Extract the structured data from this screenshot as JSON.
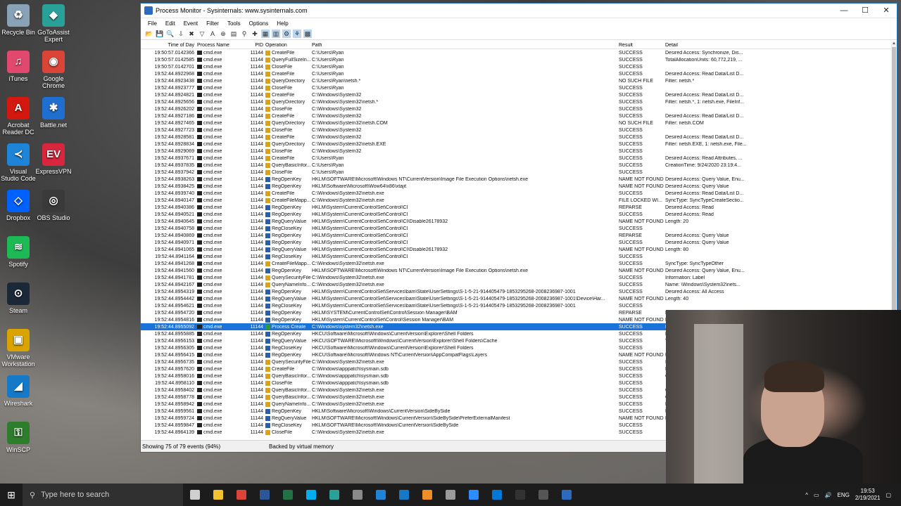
{
  "desktop_icons": [
    {
      "label": "Recycle Bin",
      "icon": "recycle-bin-icon",
      "color": "#8aa2b8",
      "glyph": "♻",
      "x": 0
    },
    {
      "label": "GoToAssist Expert",
      "icon": "gotoassist-icon",
      "color": "#2aa198",
      "glyph": "◆",
      "x": 1
    },
    {
      "label": "iTunes",
      "icon": "itunes-icon",
      "color": "#e0486e",
      "glyph": "♫",
      "x": 0
    },
    {
      "label": "Google Chrome",
      "icon": "chrome-icon",
      "color": "#db4437",
      "glyph": "◉",
      "x": 1
    },
    {
      "label": "Acrobat Reader DC",
      "icon": "acrobat-icon",
      "color": "#d4170f",
      "glyph": "A",
      "x": 0
    },
    {
      "label": "Battle.net",
      "icon": "battlenet-icon",
      "color": "#1f6fd1",
      "glyph": "✱",
      "x": 1
    },
    {
      "label": "Visual Studio Code",
      "icon": "vscode-icon",
      "color": "#1d84d8",
      "glyph": "≺",
      "x": 0
    },
    {
      "label": "ExpressVPN",
      "icon": "expressvpn-icon",
      "color": "#d7263d",
      "glyph": "EV",
      "x": 1
    },
    {
      "label": "Dropbox",
      "icon": "dropbox-icon",
      "color": "#0061fe",
      "glyph": "◇",
      "x": 0
    },
    {
      "label": "OBS Studio",
      "icon": "obs-icon",
      "color": "#3a3a3a",
      "glyph": "◎",
      "x": 1
    },
    {
      "label": "Spotify",
      "icon": "spotify-icon",
      "color": "#1db954",
      "glyph": "≋",
      "x": 0
    },
    {
      "label": "Steam",
      "icon": "steam-icon",
      "color": "#1b2838",
      "glyph": "⊙",
      "x": 0
    },
    {
      "label": "VMware Workstation",
      "icon": "vmware-icon",
      "color": "#d9a400",
      "glyph": "▣",
      "x": 0
    },
    {
      "label": "Wireshark",
      "icon": "wireshark-icon",
      "color": "#1679c8",
      "glyph": "◢",
      "x": 0
    },
    {
      "label": "WinSCP",
      "icon": "winscp-icon",
      "color": "#2d7d2d",
      "glyph": "⚿",
      "x": 0
    }
  ],
  "window": {
    "title": "Process Monitor - Sysinternals: www.sysinternals.com",
    "menu": [
      "File",
      "Edit",
      "Event",
      "Filter",
      "Tools",
      "Options",
      "Help"
    ],
    "columns": {
      "time": "Time of Day",
      "process": "Process Name",
      "pid": "PID",
      "operation": "Operation",
      "path": "Path",
      "result": "Result",
      "detail": "Detail"
    },
    "rows": [
      {
        "time": "19:50:57.0142366",
        "proc": "cmd.exe",
        "pid": "11144",
        "op": "CreateFile",
        "t": "file",
        "path": "C:\\Users\\Ryan",
        "res": "SUCCESS",
        "det": "Desired Access: Synchronize, Dis..."
      },
      {
        "time": "19:50:57.0142585",
        "proc": "cmd.exe",
        "pid": "11144",
        "op": "QueryFullSizeIn...",
        "t": "file",
        "path": "C:\\Users\\Ryan",
        "res": "SUCCESS",
        "det": "TotalAllocationUnits: 60,772,219, ..."
      },
      {
        "time": "19:50:57.0142701",
        "proc": "cmd.exe",
        "pid": "11144",
        "op": "CloseFile",
        "t": "file",
        "path": "C:\\Users\\Ryan",
        "res": "SUCCESS",
        "det": ""
      },
      {
        "time": "19:52:44.8922968",
        "proc": "cmd.exe",
        "pid": "11144",
        "op": "CreateFile",
        "t": "file",
        "path": "C:\\Users\\Ryan",
        "res": "SUCCESS",
        "det": "Desired Access: Read Data/List D..."
      },
      {
        "time": "19:52:44.8923438",
        "proc": "cmd.exe",
        "pid": "11144",
        "op": "QueryDirectory",
        "t": "file",
        "path": "C:\\Users\\Ryan\\netsh.*",
        "res": "NO SUCH FILE",
        "det": "Filter: netsh.*"
      },
      {
        "time": "19:52:44.8923777",
        "proc": "cmd.exe",
        "pid": "11144",
        "op": "CloseFile",
        "t": "file",
        "path": "C:\\Users\\Ryan",
        "res": "SUCCESS",
        "det": ""
      },
      {
        "time": "19:52:44.8924821",
        "proc": "cmd.exe",
        "pid": "11144",
        "op": "CreateFile",
        "t": "file",
        "path": "C:\\Windows\\System32",
        "res": "SUCCESS",
        "det": "Desired Access: Read Data/List D..."
      },
      {
        "time": "19:52:44.8925656",
        "proc": "cmd.exe",
        "pid": "11144",
        "op": "QueryDirectory",
        "t": "file",
        "path": "C:\\Windows\\System32\\netsh.*",
        "res": "SUCCESS",
        "det": "Filter: netsh.*, 1: netsh.exe, FileInf..."
      },
      {
        "time": "19:52:44.8926202",
        "proc": "cmd.exe",
        "pid": "11144",
        "op": "CloseFile",
        "t": "file",
        "path": "C:\\Windows\\System32",
        "res": "SUCCESS",
        "det": ""
      },
      {
        "time": "19:52:44.8927186",
        "proc": "cmd.exe",
        "pid": "11144",
        "op": "CreateFile",
        "t": "file",
        "path": "C:\\Windows\\System32",
        "res": "SUCCESS",
        "det": "Desired Access: Read Data/List D..."
      },
      {
        "time": "19:52:44.8927465",
        "proc": "cmd.exe",
        "pid": "11144",
        "op": "QueryDirectory",
        "t": "file",
        "path": "C:\\Windows\\System32\\netsh.COM",
        "res": "NO SUCH FILE",
        "det": "Filter: netsh.COM"
      },
      {
        "time": "19:52:44.8927723",
        "proc": "cmd.exe",
        "pid": "11144",
        "op": "CloseFile",
        "t": "file",
        "path": "C:\\Windows\\System32",
        "res": "SUCCESS",
        "det": ""
      },
      {
        "time": "19:52:44.8928581",
        "proc": "cmd.exe",
        "pid": "11144",
        "op": "CreateFile",
        "t": "file",
        "path": "C:\\Windows\\System32",
        "res": "SUCCESS",
        "det": "Desired Access: Read Data/List D..."
      },
      {
        "time": "19:52:44.8928834",
        "proc": "cmd.exe",
        "pid": "11144",
        "op": "QueryDirectory",
        "t": "file",
        "path": "C:\\Windows\\System32\\netsh.EXE",
        "res": "SUCCESS",
        "det": "Filter: netsh.EXE, 1: netsh.exe, File..."
      },
      {
        "time": "19:52:44.8929069",
        "proc": "cmd.exe",
        "pid": "11144",
        "op": "CloseFile",
        "t": "file",
        "path": "C:\\Windows\\System32",
        "res": "SUCCESS",
        "det": ""
      },
      {
        "time": "19:52:44.8937671",
        "proc": "cmd.exe",
        "pid": "11144",
        "op": "CreateFile",
        "t": "file",
        "path": "C:\\Users\\Ryan",
        "res": "SUCCESS",
        "det": "Desired Access: Read Attributes, ..."
      },
      {
        "time": "19:52:44.8937835",
        "proc": "cmd.exe",
        "pid": "11144",
        "op": "QueryBasicInfor...",
        "t": "file",
        "path": "C:\\Users\\Ryan",
        "res": "SUCCESS",
        "det": "CreationTime: 9/24/2020 23:19:4..."
      },
      {
        "time": "19:52:44.8937942",
        "proc": "cmd.exe",
        "pid": "11144",
        "op": "CloseFile",
        "t": "file",
        "path": "C:\\Users\\Ryan",
        "res": "SUCCESS",
        "det": ""
      },
      {
        "time": "19:52:44.8938263",
        "proc": "cmd.exe",
        "pid": "11144",
        "op": "RegOpenKey",
        "t": "reg",
        "path": "HKLM\\SOFTWARE\\Microsoft\\Windows NT\\CurrentVersion\\Image File Execution Options\\netsh.exe",
        "res": "NAME NOT FOUND",
        "det": "Desired Access: Query Value, Enu..."
      },
      {
        "time": "19:52:44.8938425",
        "proc": "cmd.exe",
        "pid": "11144",
        "op": "RegOpenKey",
        "t": "reg",
        "path": "HKLM\\Software\\Microsoft\\Wow64\\x86\\xtajit",
        "res": "NAME NOT FOUND",
        "det": "Desired Access: Query Value"
      },
      {
        "time": "19:52:44.8939740",
        "proc": "cmd.exe",
        "pid": "11144",
        "op": "CreateFile",
        "t": "file",
        "path": "C:\\Windows\\System32\\netsh.exe",
        "res": "SUCCESS",
        "det": "Desired Access: Read Data/List D..."
      },
      {
        "time": "19:52:44.8940147",
        "proc": "cmd.exe",
        "pid": "11144",
        "op": "CreateFileMapp...",
        "t": "file",
        "path": "C:\\Windows\\System32\\netsh.exe",
        "res": "FILE LOCKED WI...",
        "det": "SyncType: SyncTypeCreateSectio..."
      },
      {
        "time": "19:52:44.8940386",
        "proc": "cmd.exe",
        "pid": "11144",
        "op": "RegOpenKey",
        "t": "reg",
        "path": "HKLM\\System\\CurrentControlSet\\Control\\CI",
        "res": "REPARSE",
        "det": "Desired Access: Read"
      },
      {
        "time": "19:52:44.8940521",
        "proc": "cmd.exe",
        "pid": "11144",
        "op": "RegOpenKey",
        "t": "reg",
        "path": "HKLM\\System\\CurrentControlSet\\Control\\CI",
        "res": "SUCCESS",
        "det": "Desired Access: Read"
      },
      {
        "time": "19:52:44.8940645",
        "proc": "cmd.exe",
        "pid": "11144",
        "op": "RegQueryValue",
        "t": "reg",
        "path": "HKLM\\System\\CurrentControlSet\\Control\\CI\\Disable26178932",
        "res": "NAME NOT FOUND",
        "det": "Length: 20"
      },
      {
        "time": "19:52:44.8940758",
        "proc": "cmd.exe",
        "pid": "11144",
        "op": "RegCloseKey",
        "t": "reg",
        "path": "HKLM\\System\\CurrentControlSet\\Control\\CI",
        "res": "SUCCESS",
        "det": ""
      },
      {
        "time": "19:52:44.8940869",
        "proc": "cmd.exe",
        "pid": "11144",
        "op": "RegOpenKey",
        "t": "reg",
        "path": "HKLM\\System\\CurrentControlSet\\Control\\CI",
        "res": "REPARSE",
        "det": "Desired Access: Query Value"
      },
      {
        "time": "19:52:44.8940971",
        "proc": "cmd.exe",
        "pid": "11144",
        "op": "RegOpenKey",
        "t": "reg",
        "path": "HKLM\\System\\CurrentControlSet\\Control\\CI",
        "res": "SUCCESS",
        "det": "Desired Access: Query Value"
      },
      {
        "time": "19:52:44.8941065",
        "proc": "cmd.exe",
        "pid": "11144",
        "op": "RegQueryValue",
        "t": "reg",
        "path": "HKLM\\System\\CurrentControlSet\\Control\\CI\\Disable26178932",
        "res": "NAME NOT FOUND",
        "det": "Length: 80"
      },
      {
        "time": "19:52:44.8941164",
        "proc": "cmd.exe",
        "pid": "11144",
        "op": "RegCloseKey",
        "t": "reg",
        "path": "HKLM\\System\\CurrentControlSet\\Control\\CI",
        "res": "SUCCESS",
        "det": ""
      },
      {
        "time": "19:52:44.8941268",
        "proc": "cmd.exe",
        "pid": "11144",
        "op": "CreateFileMapp...",
        "t": "file",
        "path": "C:\\Windows\\System32\\netsh.exe",
        "res": "SUCCESS",
        "det": "SyncType: SyncTypeOther"
      },
      {
        "time": "19:52:44.8941560",
        "proc": "cmd.exe",
        "pid": "11144",
        "op": "RegOpenKey",
        "t": "reg",
        "path": "HKLM\\SOFTWARE\\Microsoft\\Windows NT\\CurrentVersion\\Image File Execution Options\\netsh.exe",
        "res": "NAME NOT FOUND",
        "det": "Desired Access: Query Value, Enu..."
      },
      {
        "time": "19:52:44.8941781",
        "proc": "cmd.exe",
        "pid": "11144",
        "op": "QuerySecurityFile",
        "t": "file",
        "path": "C:\\Windows\\System32\\netsh.exe",
        "res": "SUCCESS",
        "det": "Information: Label"
      },
      {
        "time": "19:52:44.8942167",
        "proc": "cmd.exe",
        "pid": "11144",
        "op": "QueryNameInfo...",
        "t": "file",
        "path": "C:\\Windows\\System32\\netsh.exe",
        "res": "SUCCESS",
        "det": "Name: \\Windows\\System32\\nets..."
      },
      {
        "time": "19:52:44.8954319",
        "proc": "cmd.exe",
        "pid": "11144",
        "op": "RegOpenKey",
        "t": "reg",
        "path": "HKLM\\System\\CurrentControlSet\\Services\\bam\\State\\UserSettings\\S-1-5-21-914405479-1853295268-2008236987-1001",
        "res": "SUCCESS",
        "det": "Desired Access: All Access"
      },
      {
        "time": "19:52:44.8954442",
        "proc": "cmd.exe",
        "pid": "11144",
        "op": "RegQueryValue",
        "t": "reg",
        "path": "HKLM\\System\\CurrentControlSet\\Services\\bam\\State\\UserSettings\\S-1-5-21-914405479-1853295268-2008236987-1001\\Device\\Har...",
        "res": "NAME NOT FOUND",
        "det": "Length: 40"
      },
      {
        "time": "19:52:44.8954621",
        "proc": "cmd.exe",
        "pid": "11144",
        "op": "RegCloseKey",
        "t": "reg",
        "path": "HKLM\\System\\CurrentControlSet\\Services\\bam\\State\\UserSettings\\S-1-5-21-914405479-1853295268-2008236987-1001",
        "res": "SUCCESS",
        "det": ""
      },
      {
        "time": "19:52:44.8954720",
        "proc": "cmd.exe",
        "pid": "11144",
        "op": "RegOpenKey",
        "t": "reg",
        "path": "HKLM\\SYSTEM\\CurrentControlSet\\Control\\Session Manager\\BAM",
        "res": "REPARSE",
        "det": "D"
      },
      {
        "time": "19:52:44.8954816",
        "proc": "cmd.exe",
        "pid": "11144",
        "op": "RegOpenKey",
        "t": "reg",
        "path": "HKLM\\System\\CurrentControlSet\\Control\\Session Manager\\BAM",
        "res": "NAME NOT FOUND",
        "det": "D"
      },
      {
        "time": "19:52:44.8955092",
        "proc": "cmd.exe",
        "pid": "11144",
        "op": "Process Create",
        "t": "proc",
        "path": "C:\\Windows\\system32\\netsh.exe",
        "res": "SUCCESS",
        "det": "PI",
        "selected": true
      },
      {
        "time": "19:52:44.8955885",
        "proc": "cmd.exe",
        "pid": "11144",
        "op": "RegOpenKey",
        "t": "reg",
        "path": "HKCU\\Software\\Microsoft\\Windows\\CurrentVersion\\Explorer\\Shell Folders",
        "res": "SUCCESS",
        "det": "D"
      },
      {
        "time": "19:52:44.8956153",
        "proc": "cmd.exe",
        "pid": "11144",
        "op": "RegQueryValue",
        "t": "reg",
        "path": "HKCU\\SOFTWARE\\Microsoft\\Windows\\CurrentVersion\\Explorer\\Shell Folders\\Cache",
        "res": "SUCCESS",
        "det": "T"
      },
      {
        "time": "19:52:44.8956305",
        "proc": "cmd.exe",
        "pid": "11144",
        "op": "RegCloseKey",
        "t": "reg",
        "path": "HKCU\\Software\\Microsoft\\Windows\\CurrentVersion\\Explorer\\Shell Folders",
        "res": "SUCCESS",
        "det": ""
      },
      {
        "time": "19:52:44.8956415",
        "proc": "cmd.exe",
        "pid": "11144",
        "op": "RegOpenKey",
        "t": "reg",
        "path": "HKCU\\Software\\Microsoft\\Windows NT\\CurrentVersion\\AppCompatFlags\\Layers",
        "res": "NAME NOT FOUND",
        "det": "D"
      },
      {
        "time": "19:52:44.8956735",
        "proc": "cmd.exe",
        "pid": "11144",
        "op": "QuerySecurityFile",
        "t": "file",
        "path": "C:\\Windows\\System32\\netsh.exe",
        "res": "SUCCESS",
        "det": "In"
      },
      {
        "time": "19:52:44.8957620",
        "proc": "cmd.exe",
        "pid": "11144",
        "op": "CreateFile",
        "t": "file",
        "path": "C:\\Windows\\apppatch\\sysmain.sdb",
        "res": "SUCCESS",
        "det": "D"
      },
      {
        "time": "19:52:44.8958016",
        "proc": "cmd.exe",
        "pid": "11144",
        "op": "QueryBasicInfor...",
        "t": "file",
        "path": "C:\\Windows\\apppatch\\sysmain.sdb",
        "res": "SUCCESS",
        "det": "C"
      },
      {
        "time": "19:52:44.8958110",
        "proc": "cmd.exe",
        "pid": "11144",
        "op": "CloseFile",
        "t": "file",
        "path": "C:\\Windows\\apppatch\\sysmain.sdb",
        "res": "SUCCESS",
        "det": ""
      },
      {
        "time": "19:52:44.8958402",
        "proc": "cmd.exe",
        "pid": "11144",
        "op": "QueryBasicInfor...",
        "t": "file",
        "path": "C:\\Windows\\System32\\netsh.exe",
        "res": "SUCCESS",
        "det": "C"
      },
      {
        "time": "19:52:44.8958778",
        "proc": "cmd.exe",
        "pid": "11144",
        "op": "QueryBasicInfor...",
        "t": "file",
        "path": "C:\\Windows\\System32\\netsh.exe",
        "res": "SUCCESS",
        "det": "C"
      },
      {
        "time": "19:52:44.8958942",
        "proc": "cmd.exe",
        "pid": "11144",
        "op": "QueryNameInfo...",
        "t": "file",
        "path": "C:\\Windows\\System32\\netsh.exe",
        "res": "SUCCESS",
        "det": "N"
      },
      {
        "time": "19:52:44.8959561",
        "proc": "cmd.exe",
        "pid": "11144",
        "op": "RegOpenKey",
        "t": "reg",
        "path": "HKLM\\Software\\Microsoft\\Windows\\CurrentVersion\\SideBySide",
        "res": "SUCCESS",
        "det": "D"
      },
      {
        "time": "19:52:44.8959724",
        "proc": "cmd.exe",
        "pid": "11144",
        "op": "RegQueryValue",
        "t": "reg",
        "path": "HKLM\\SOFTWARE\\Microsoft\\Windows\\CurrentVersion\\SideBySide\\PreferExternalManifest",
        "res": "NAME NOT FOUND",
        "det": "L"
      },
      {
        "time": "19:52:44.8959847",
        "proc": "cmd.exe",
        "pid": "11144",
        "op": "RegCloseKey",
        "t": "reg",
        "path": "HKLM\\SOFTWARE\\Microsoft\\Windows\\CurrentVersion\\SideBySide",
        "res": "SUCCESS",
        "det": ""
      },
      {
        "time": "19:52:44.8964139",
        "proc": "cmd.exe",
        "pid": "11144",
        "op": "CloseFile",
        "t": "file",
        "path": "C:\\Windows\\System32\\netsh.exe",
        "res": "SUCCESS",
        "det": ""
      }
    ],
    "status": {
      "events": "Showing 75 of 79 events (94%)",
      "memory": "Backed by virtual memory"
    }
  },
  "taskbar": {
    "search_placeholder": "Type here to search",
    "apps": [
      {
        "icon": "task-view-icon",
        "color": "#cfcfcf"
      },
      {
        "icon": "file-explorer-icon",
        "color": "#f2c12e"
      },
      {
        "icon": "chrome-icon",
        "color": "#db4437"
      },
      {
        "icon": "word-icon",
        "color": "#2b579a"
      },
      {
        "icon": "excel-icon",
        "color": "#217346"
      },
      {
        "icon": "skype-icon",
        "color": "#00aff0"
      },
      {
        "icon": "gotoassist-icon",
        "color": "#2aa198"
      },
      {
        "icon": "tool-icon",
        "color": "#888888"
      },
      {
        "icon": "vscode-icon",
        "color": "#1d84d8"
      },
      {
        "icon": "wireshark-icon",
        "color": "#1679c8"
      },
      {
        "icon": "sublime-icon",
        "color": "#f08d24"
      },
      {
        "icon": "vmware-icon",
        "color": "#9a9a9a"
      },
      {
        "icon": "zoom-icon",
        "color": "#2d8cff"
      },
      {
        "icon": "mail-icon",
        "color": "#0078d4"
      },
      {
        "icon": "terminal-icon",
        "color": "#333333"
      },
      {
        "icon": "obs-icon",
        "color": "#555555"
      },
      {
        "icon": "procmon-icon",
        "color": "#2c6bbf"
      }
    ],
    "language": "ENG",
    "time": "19:53",
    "date": "2/19/2021"
  }
}
